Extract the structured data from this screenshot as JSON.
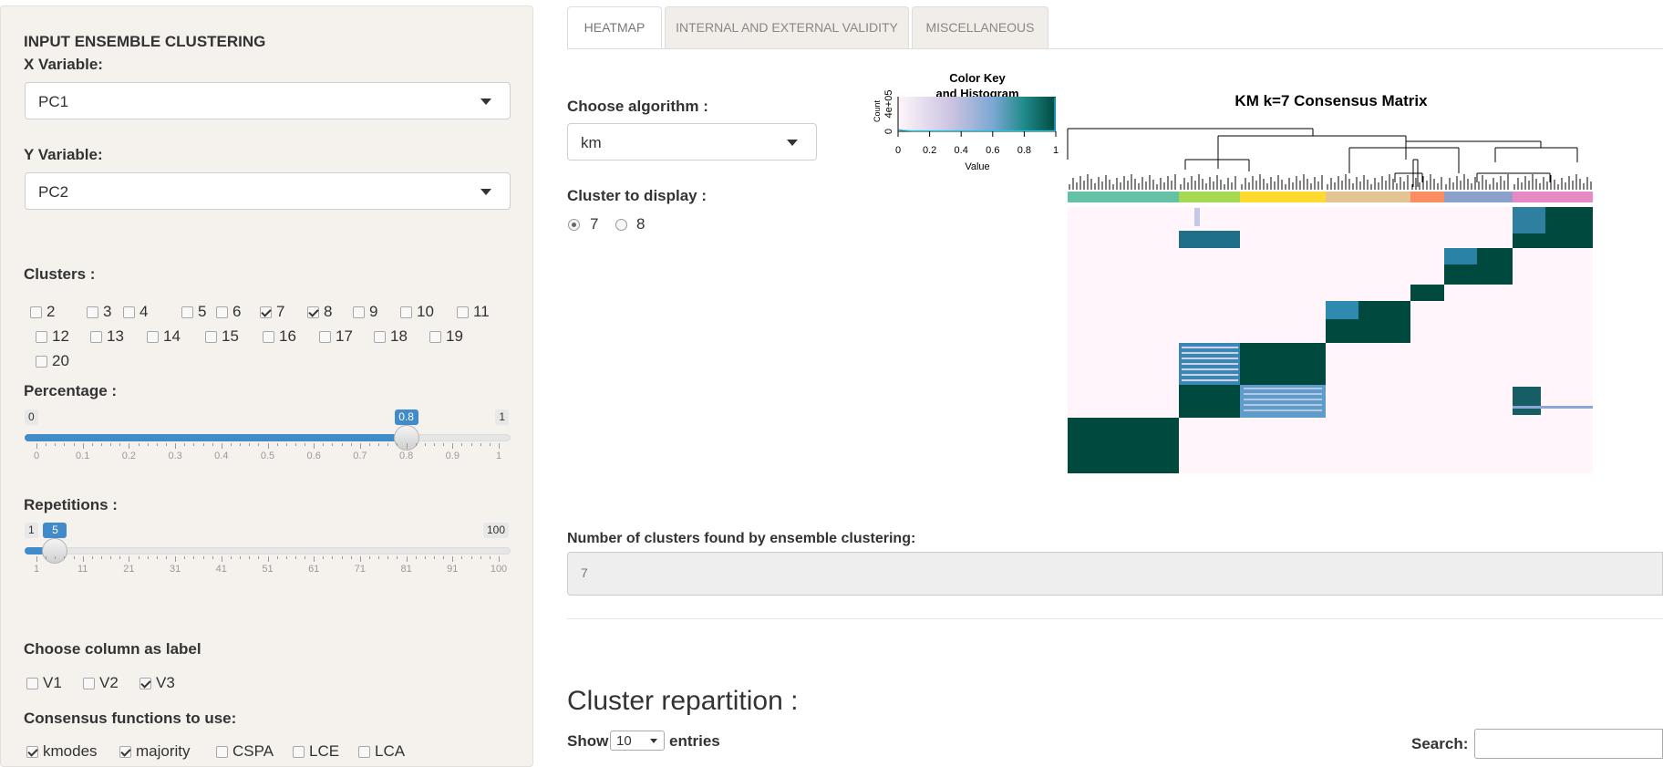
{
  "sidebar": {
    "title": "INPUT ENSEMBLE CLUSTERING",
    "x_variable": {
      "label": "X Variable:",
      "value": "PC1"
    },
    "y_variable": {
      "label": "Y Variable:",
      "value": "PC2"
    },
    "clusters": {
      "label": "Clusters :",
      "options": [
        {
          "label": "2",
          "checked": false
        },
        {
          "label": "3",
          "checked": false
        },
        {
          "label": "4",
          "checked": false
        },
        {
          "label": "5",
          "checked": false
        },
        {
          "label": "6",
          "checked": false
        },
        {
          "label": "7",
          "checked": true
        },
        {
          "label": "8",
          "checked": true
        },
        {
          "label": "9",
          "checked": false
        },
        {
          "label": "10",
          "checked": false
        },
        {
          "label": "11",
          "checked": false
        },
        {
          "label": "12",
          "checked": false
        },
        {
          "label": "13",
          "checked": false
        },
        {
          "label": "14",
          "checked": false
        },
        {
          "label": "15",
          "checked": false
        },
        {
          "label": "16",
          "checked": false
        },
        {
          "label": "17",
          "checked": false
        },
        {
          "label": "18",
          "checked": false
        },
        {
          "label": "19",
          "checked": false
        },
        {
          "label": "20",
          "checked": false
        }
      ]
    },
    "percentage": {
      "label": "Percentage :",
      "min": "0",
      "max": "1",
      "value": "0.8",
      "value_num": 0.8,
      "ticks": [
        "0",
        "0.1",
        "0.2",
        "0.3",
        "0.4",
        "0.5",
        "0.6",
        "0.7",
        "0.8",
        "0.9",
        "1"
      ]
    },
    "repetitions": {
      "label": "Repetitions :",
      "min": "1",
      "max": "100",
      "value": "5",
      "value_num": 5,
      "ticks": [
        "1",
        "11",
        "21",
        "31",
        "41",
        "51",
        "61",
        "71",
        "81",
        "91",
        "100"
      ]
    },
    "label_column": {
      "label": "Choose column as label",
      "options": [
        {
          "label": "V1",
          "checked": false
        },
        {
          "label": "V2",
          "checked": false
        },
        {
          "label": "V3",
          "checked": true
        }
      ]
    },
    "consensus": {
      "label": "Consensus functions to use:",
      "options": [
        {
          "label": "kmodes",
          "checked": true
        },
        {
          "label": "majority",
          "checked": true
        },
        {
          "label": "CSPA",
          "checked": false
        },
        {
          "label": "LCE",
          "checked": false
        },
        {
          "label": "LCA",
          "checked": false
        }
      ]
    }
  },
  "tabs": [
    {
      "label": "HEATMAP",
      "active": true
    },
    {
      "label": "INTERNAL AND EXTERNAL VALIDITY",
      "active": false
    },
    {
      "label": "MISCELLANEOUS",
      "active": false
    }
  ],
  "main": {
    "algorithm": {
      "label": "Choose algorithm :",
      "value": "km"
    },
    "cluster_display": {
      "label": "Cluster to display :",
      "options": [
        {
          "label": "7",
          "selected": true
        },
        {
          "label": "8",
          "selected": false
        }
      ]
    },
    "heatmap": {
      "title": "KM k=7 Consensus Matrix",
      "color_key_title_1": "Color Key",
      "color_key_title_2": "and Histogram",
      "color_key_ylabel": "Count",
      "color_key_yticks": [
        "0",
        "4e+05"
      ],
      "color_key_xticks": [
        "0",
        "0.2",
        "0.4",
        "0.6",
        "0.8",
        "1"
      ],
      "color_key_xlabel": "Value",
      "cluster_colors": [
        "#66c2a5",
        "#a6d854",
        "#ffd92f",
        "#e5c494",
        "#fc8d62",
        "#8da0cb",
        "#e78ac3"
      ],
      "cell_color_high": "#00493e",
      "cell_color_low": "#fff5fa"
    },
    "clusters_found": {
      "label": "Number of clusters found by ensemble clustering:",
      "value": "7"
    },
    "repartition": {
      "heading": "Cluster repartition :",
      "show_label": "Show",
      "show_value": "10",
      "entries_label": "entries",
      "search_label": "Search:"
    }
  }
}
